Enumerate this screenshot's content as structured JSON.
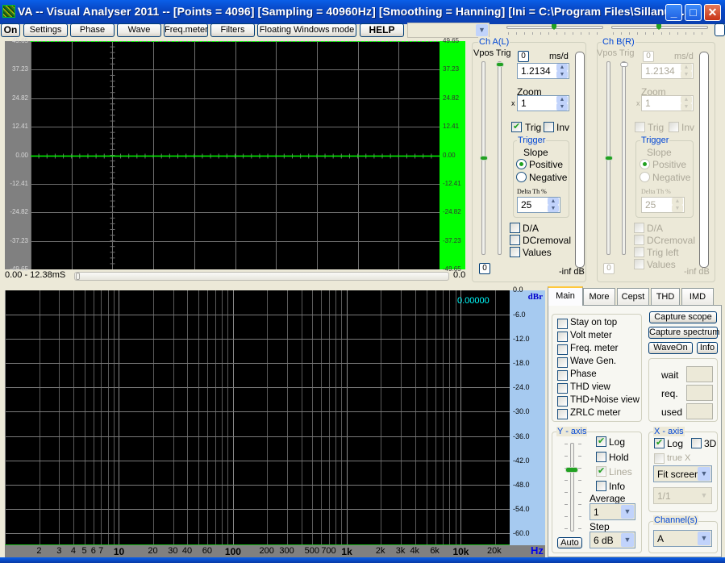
{
  "window": {
    "title": "VA -- Visual Analyser 2011 --  [Points = 4096]  [Sampling = 40960Hz]  [Smoothing = Hanning]  [Ini = C:\\Program Files\\Sillanum...",
    "minimize_icon": "minimize-icon",
    "maximize_icon": "maximize-icon",
    "close_icon": "close-icon"
  },
  "toolbar": {
    "buttons": [
      {
        "label": "On"
      },
      {
        "label": "Settings"
      },
      {
        "label": "Phase"
      },
      {
        "label": "Wave"
      },
      {
        "label": "Freq.meter"
      },
      {
        "label": "Filters"
      },
      {
        "label": "Floating Windows mode"
      },
      {
        "label": "HELP"
      }
    ],
    "combo_value": "",
    "slider_a_value": 0.5,
    "slider_b_value": 0.5
  },
  "scope": {
    "y_labels": [
      "49.65",
      "37.23",
      "24.82",
      "12.41",
      "0.00",
      "-12.41",
      "-24.82",
      "-37.23",
      "-49.65"
    ],
    "time_range": "0.00 - 12.38mS",
    "right_value": "0.0"
  },
  "channel_a": {
    "title": "Ch A(L)",
    "vpos_trig_label": "Vpos Trig",
    "zero_button": "0",
    "ms_div_label": "ms/d",
    "ms_div_value": "1.2134",
    "zoom_label": "Zoom",
    "zoom_prefix": "x",
    "zoom_value": "1",
    "trig_label": "Trig",
    "trig_checked": true,
    "inv_label": "Inv",
    "inv_checked": false,
    "trigger_group": "Trigger",
    "slope_label": "Slope",
    "positive_label": "Positive",
    "negative_label": "Negative",
    "slope_selected": "Positive",
    "delta_th_label": "Delta Th %",
    "delta_th_value": "25",
    "da_label": "D/A",
    "dcremoval_label": "DCremoval",
    "values_label": "Values",
    "vpos_zero_button": "0",
    "level_label": "-inf dB"
  },
  "channel_b": {
    "title": "Ch B(R)",
    "vpos_trig_label": "Vpos Trig",
    "zero_button": "0",
    "ms_div_label": "ms/d",
    "ms_div_value": "1.2134",
    "zoom_label": "Zoom",
    "zoom_prefix": "x",
    "zoom_value": "1",
    "trig_label": "Trig",
    "inv_label": "Inv",
    "trigger_group": "Trigger",
    "slope_label": "Slope",
    "positive_label": "Positive",
    "negative_label": "Negative",
    "delta_th_label": "Delta Th %",
    "delta_th_value": "25",
    "da_label": "D/A",
    "dcremoval_label": "DCremoval",
    "trig_left_label": "Trig left",
    "values_label": "Values",
    "vpos_zero_button": "0",
    "level_label": "-inf dB"
  },
  "spectrum": {
    "unit_label": "dBr",
    "value_readout": "0.00000",
    "y_labels": [
      "0.0",
      "-6.0",
      "-12.0",
      "-18.0",
      "-24.0",
      "-30.0",
      "-36.0",
      "-42.0",
      "-48.0",
      "-54.0",
      "-60.0"
    ],
    "x_labels": [
      {
        "t": "2",
        "b": false
      },
      {
        "t": "3",
        "b": false
      },
      {
        "t": "4",
        "b": false
      },
      {
        "t": "5",
        "b": false
      },
      {
        "t": "6",
        "b": false
      },
      {
        "t": "7",
        "b": false
      },
      {
        "t": "10",
        "b": true
      },
      {
        "t": "20",
        "b": false
      },
      {
        "t": "30",
        "b": false
      },
      {
        "t": "40",
        "b": false
      },
      {
        "t": "60",
        "b": false
      },
      {
        "t": "100",
        "b": true
      },
      {
        "t": "200",
        "b": false
      },
      {
        "t": "300",
        "b": false
      },
      {
        "t": "500",
        "b": false
      },
      {
        "t": "700",
        "b": false
      },
      {
        "t": "1k",
        "b": true
      },
      {
        "t": "2k",
        "b": false
      },
      {
        "t": "3k",
        "b": false
      },
      {
        "t": "4k",
        "b": false
      },
      {
        "t": "6k",
        "b": false
      },
      {
        "t": "10k",
        "b": true
      },
      {
        "t": "20k",
        "b": false
      }
    ],
    "x_unit": "Hz"
  },
  "tabs": {
    "items": [
      {
        "label": "Main"
      },
      {
        "label": "More"
      },
      {
        "label": "Cepst"
      },
      {
        "label": "THD"
      },
      {
        "label": "IMD"
      }
    ],
    "active": "Main"
  },
  "main_tab": {
    "options": [
      {
        "label": "Stay on top",
        "checked": false
      },
      {
        "label": "Volt meter",
        "checked": false
      },
      {
        "label": "Freq. meter",
        "checked": false
      },
      {
        "label": "Wave Gen.",
        "checked": false
      },
      {
        "label": "Phase",
        "checked": false
      },
      {
        "label": "THD view",
        "checked": false
      },
      {
        "label": "THD+Noise view",
        "checked": false
      },
      {
        "label": "ZRLC meter",
        "checked": false
      }
    ],
    "capture_scope": "Capture scope",
    "capture_spectrum": "Capture spectrum",
    "wave_on": "WaveOn",
    "info": "Info",
    "wait_label": "wait",
    "req_label": "req.",
    "used_label": "used",
    "wait_value": "",
    "req_value": "",
    "used_value": ""
  },
  "y_axis": {
    "title": "Y - axis",
    "log_label": "Log",
    "log_checked": true,
    "hold_label": "Hold",
    "hold_checked": false,
    "lines_label": "Lines",
    "lines_checked": true,
    "info_label": "Info",
    "info_checked": false,
    "average_label": "Average",
    "average_value": "1",
    "step_label": "Step",
    "step_value": "6 dB",
    "auto_button": "Auto",
    "slider_value": 0.3
  },
  "x_axis": {
    "title": "X - axis",
    "log_label": "Log",
    "log_checked": true,
    "3d_label": "3D",
    "3d_checked": false,
    "truex_label": "true X",
    "scale_value": "Fit screen",
    "ratio_value": "1/1"
  },
  "channels": {
    "title": "Channel(s)",
    "value": "A"
  },
  "colors": {
    "trace": "#00ff00",
    "scope_bg": "#000000",
    "spectrum_axis": "#a6caf0",
    "readout": "#00ffff",
    "group_title": "#0046d5"
  }
}
